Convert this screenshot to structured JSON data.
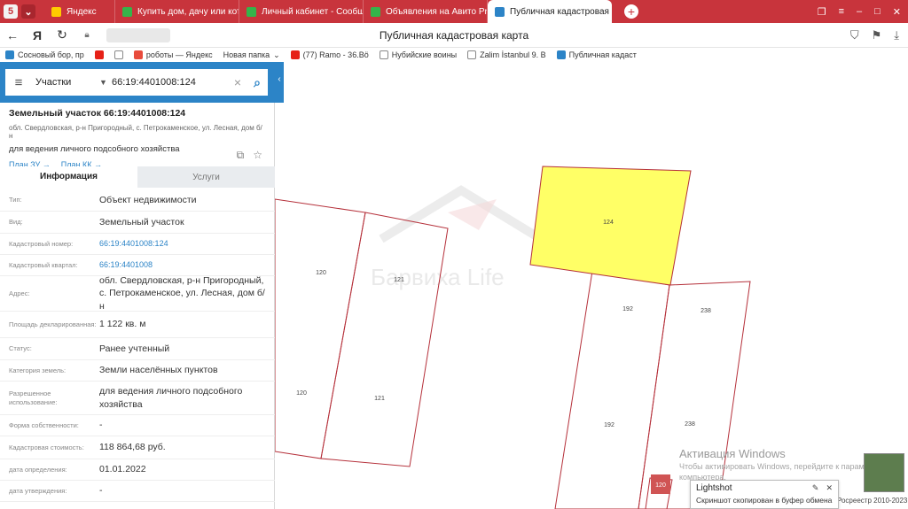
{
  "browser": {
    "tabs": [
      {
        "label": "Яндекс",
        "color": "#ffcc00"
      },
      {
        "label": "Купить дом, дачу или кот",
        "color": "#35b44a"
      },
      {
        "label": "Личный кабинет - Сообщ",
        "color": "#35b44a"
      },
      {
        "label": "Объявления на Авито Pro",
        "color": "#35b44a"
      },
      {
        "label": "Публичная кадастровая",
        "color": "#2c84c7",
        "active": true
      }
    ],
    "page_title": "Публичная кадастровая карта",
    "bookmarks": [
      "Сосновый бор, пр",
      "",
      "роботы — Яндекс",
      "Новая папка",
      "(77) Ramo - 36.Bö",
      "Нубийские воины",
      "Zalim İstanbul 9. B",
      "Публичная кадаст"
    ]
  },
  "search": {
    "type": "Участки",
    "value": "66:19:4401008:124"
  },
  "parcel": {
    "title": "Земельный участок 66:19:4401008:124",
    "address_small": "обл. Свердловская, р-н Пригородный, с. Петрокаменское, ул. Лесная, дом б/н",
    "use": "для ведения личного подсобного хозяйства",
    "links": [
      "План ЗУ",
      "План КК"
    ]
  },
  "panel_tabs": [
    "Информация",
    "Услуги"
  ],
  "info_rows": [
    {
      "label": "Тип:",
      "value": "Объект недвижимости"
    },
    {
      "label": "Вид:",
      "value": "Земельный участок"
    },
    {
      "label": "Кадастровый номер:",
      "value": "66:19:4401008:124",
      "link": true
    },
    {
      "label": "Кадастровый квартал:",
      "value": "66:19:4401008",
      "link": true
    },
    {
      "label": "Адрес:",
      "value": "обл. Свердловская, р-н Пригородный, с. Петрокаменское, ул. Лесная, дом б/н"
    },
    {
      "label": "Площадь декларированная:",
      "value": "1 122 кв. м"
    },
    {
      "label": "Статус:",
      "value": "Ранее учтенный"
    },
    {
      "label": "Категория земель:",
      "value": "Земли населённых пунктов"
    },
    {
      "label": "Разрешенное использование:",
      "value": "для ведения личного подсобного хозяйства"
    },
    {
      "label": "Форма собственности:",
      "value": "-"
    },
    {
      "label": "Кадастровая стоимость:",
      "value": "118 864,68 руб."
    },
    {
      "label": "дата определения:",
      "value": "01.01.2022"
    },
    {
      "label": "дата утверждения:",
      "value": "-"
    }
  ],
  "map": {
    "parcel_labels": [
      "120",
      "121",
      "120",
      "121",
      "124",
      "192",
      "238",
      "192",
      "238",
      "120"
    ],
    "watermark": "Барвиха Life",
    "highlight_color": "#ffff66",
    "border_color": "#b5303a"
  },
  "windows_activation": {
    "title": "Активация Windows",
    "text": "Чтобы активировать Windows, перейдите к параметрам компьютера."
  },
  "copyright": "Росреестр 2010-2023",
  "lightshot": {
    "title": "Lightshot",
    "message": "Скриншот скопирован в буфер обмена"
  }
}
